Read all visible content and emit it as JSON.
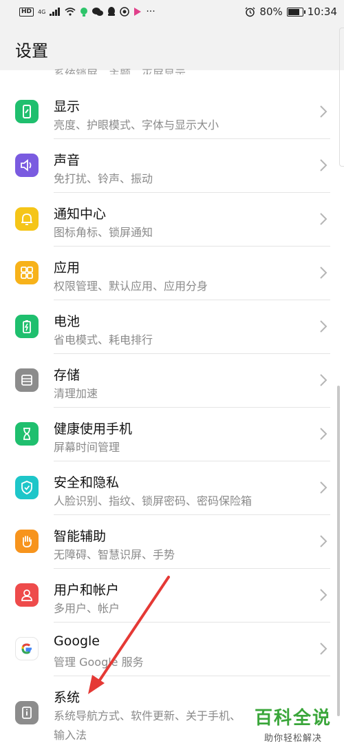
{
  "status_bar": {
    "hd": "HD",
    "network": "4G",
    "more": "···",
    "battery_percent": "80%",
    "time": "10:34",
    "battery_level": 0.8
  },
  "header": {
    "title": "设置"
  },
  "partial_item": {
    "sub": "系统锁屏、主题、灭屏显示"
  },
  "items": [
    {
      "label": "显示",
      "sub": "亮度、护眼模式、字体与显示大小",
      "icon": "display-icon",
      "color": "#1fbf6e"
    },
    {
      "label": "声音",
      "sub": "免打扰、铃声、振动",
      "icon": "speaker-icon",
      "color": "#7a5be0"
    },
    {
      "label": "通知中心",
      "sub": "图标角标、锁屏通知",
      "icon": "bell-icon",
      "color": "#f5c518"
    },
    {
      "label": "应用",
      "sub": "权限管理、默认应用、应用分身",
      "icon": "apps-grid-icon",
      "color": "#f7b21a"
    },
    {
      "label": "电池",
      "sub": "省电模式、耗电排行",
      "icon": "battery-icon",
      "color": "#1fbf6e"
    },
    {
      "label": "存储",
      "sub": "清理加速",
      "icon": "storage-icon",
      "color": "#8c8c8c"
    },
    {
      "label": "健康使用手机",
      "sub": "屏幕时间管理",
      "icon": "hourglass-icon",
      "color": "#1fbf6e"
    },
    {
      "label": "安全和隐私",
      "sub": "人脸识别、指纹、锁屏密码、密码保险箱",
      "icon": "shield-icon",
      "color": "#1ec6c9"
    },
    {
      "label": "智能辅助",
      "sub": "无障碍、智慧识屏、手势",
      "icon": "hand-icon",
      "color": "#f7941d"
    },
    {
      "label": "用户和帐户",
      "sub": "多用户、帐户",
      "icon": "user-icon",
      "color": "#ee4b4b"
    },
    {
      "label": "Google",
      "sub": "管理 Google 服务",
      "icon": "google-icon",
      "color": "#ffffff"
    }
  ],
  "last_item": {
    "label": "系统",
    "sub": "系统导航方式、软件更新、关于手机、",
    "sub2": "输入法",
    "icon": "system-info-icon",
    "color": "#8c8c8c"
  },
  "watermark": {
    "main": "百科全说",
    "sub": "助你轻松解决"
  },
  "colors": {
    "accent_arrow": "#e53935"
  }
}
